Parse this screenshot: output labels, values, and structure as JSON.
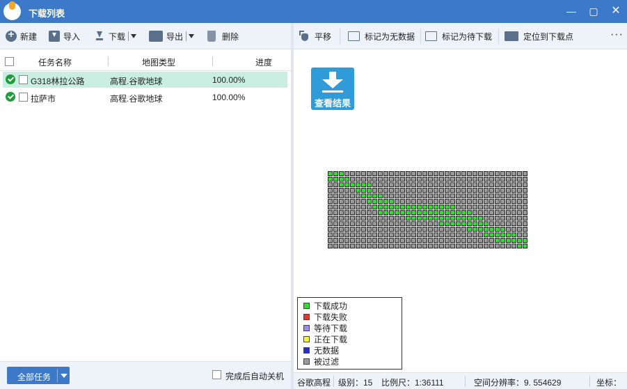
{
  "window": {
    "title": "下载列表"
  },
  "left_toolbar": {
    "new_label": "新建",
    "import_label": "导入",
    "download_label": "下载",
    "export_label": "导出",
    "delete_label": "删除"
  },
  "table": {
    "columns": [
      "任务名称",
      "地图类型",
      "进度"
    ],
    "rows": [
      {
        "name": "G318林拉公路",
        "map_type": "高程.谷歌地球",
        "progress": "100.00%",
        "status": "success",
        "selected": true
      },
      {
        "name": "拉萨市",
        "map_type": "高程.谷歌地球",
        "progress": "100.00%",
        "status": "success",
        "selected": false
      }
    ]
  },
  "left_bottom": {
    "all_tasks_label": "全部任务",
    "auto_shutdown_label": "完成后自动关机",
    "auto_shutdown_checked": false
  },
  "right_toolbar": {
    "pan_label": "平移",
    "mark_no_data_label": "标记为无数据",
    "mark_pending_label": "标记为待下载",
    "locate_label": "定位到下载点",
    "more_label": "···"
  },
  "map": {
    "view_result_label": "查看结果",
    "tile_grid": {
      "cols": 36,
      "rows": 14,
      "colors": {
        "success": "#33dd33",
        "filtered": "#9a9a9a"
      },
      "success_ranges": [
        [
          [
            0,
            2
          ]
        ],
        [
          [
            0,
            3
          ]
        ],
        [
          [
            2,
            7
          ]
        ],
        [
          [
            5,
            7
          ]
        ],
        [
          [
            6,
            9
          ]
        ],
        [
          [
            7,
            11
          ]
        ],
        [
          [
            8,
            22
          ]
        ],
        [
          [
            9,
            25
          ]
        ],
        [
          [
            14,
            27
          ]
        ],
        [
          [
            20,
            28
          ]
        ],
        [
          [
            25,
            31
          ]
        ],
        [
          [
            28,
            33
          ]
        ],
        [
          [
            30,
            35
          ]
        ],
        [
          [
            34,
            35
          ]
        ]
      ]
    },
    "legend": [
      {
        "label": "下载成功",
        "color": "#33dd33"
      },
      {
        "label": "下载失败",
        "color": "#ee3333"
      },
      {
        "label": "等待下载",
        "color": "#9c8cf0"
      },
      {
        "label": "正在下载",
        "color": "#f5f534"
      },
      {
        "label": "无数据",
        "color": "#2a2ad8"
      },
      {
        "label": "被过滤",
        "color": "#9a9a9a"
      }
    ]
  },
  "status_bar": {
    "map_name": "谷歌高程",
    "level": "级别：15",
    "scale": "比例尺：1:36111",
    "resolution": "空间分辨率：9. 554629",
    "coord": "坐标："
  }
}
